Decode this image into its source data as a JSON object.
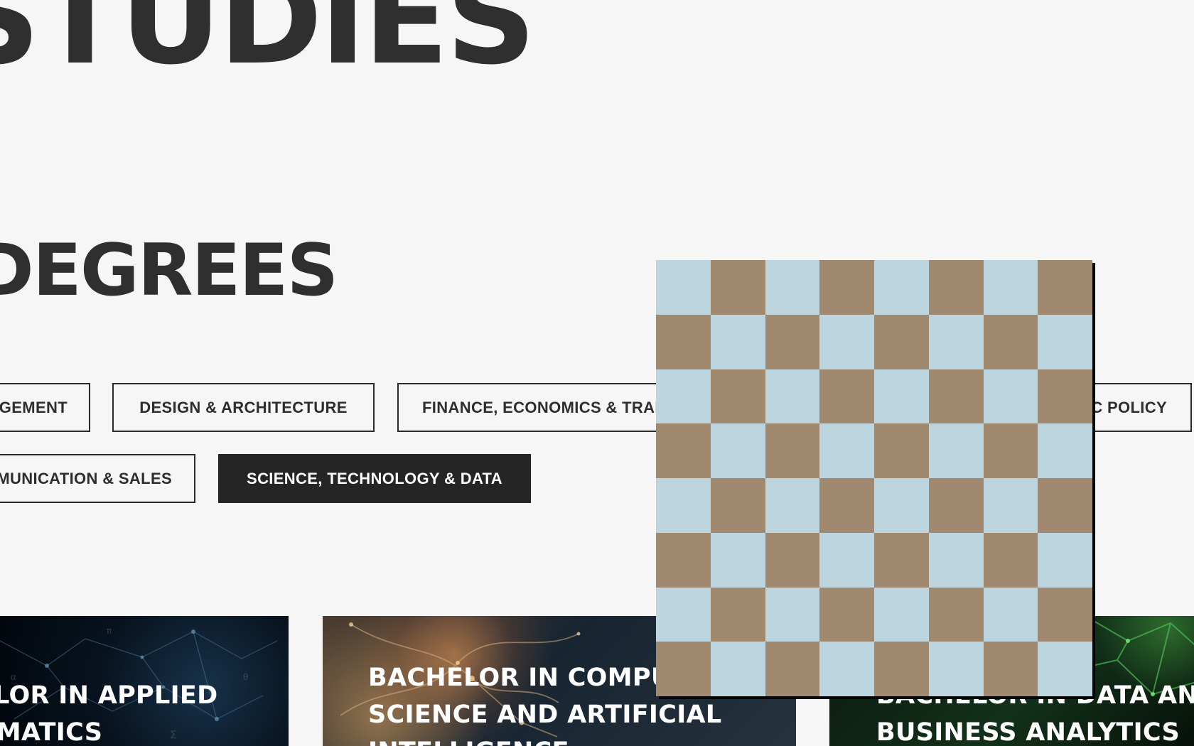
{
  "hero": {
    "title": "STUDIES"
  },
  "section": {
    "title": "DEGREES"
  },
  "filters": [
    {
      "label": "MANAGEMENT"
    },
    {
      "label": "DESIGN & ARCHITECTURE"
    },
    {
      "label": "FINANCE, ECONOMICS & TRADE"
    },
    {
      "label": "PUBLIC POLICY"
    },
    {
      "label": "COMMUNICATION & SALES"
    },
    {
      "label": "SCIENCE, TECHNOLOGY & DATA",
      "active": true
    }
  ],
  "cards": [
    {
      "title_lines": [
        "BACHELOR IN APPLIED",
        "MATHEMATICS"
      ]
    },
    {
      "title_lines": [
        "BACHELOR IN COMPUTER",
        "SCIENCE AND ARTIFICIAL",
        "INTELLIGENCE"
      ]
    },
    {
      "title_lines": [
        "BACHELOR IN DATA AND",
        "BUSINESS ANALYTICS"
      ]
    }
  ],
  "colors": {
    "page_background": "#f6f6f6",
    "heading": "#2f2f2f",
    "active_filter_background": "#252525",
    "checker_light": "#bcd5de",
    "checker_dark": "#a0896f"
  }
}
